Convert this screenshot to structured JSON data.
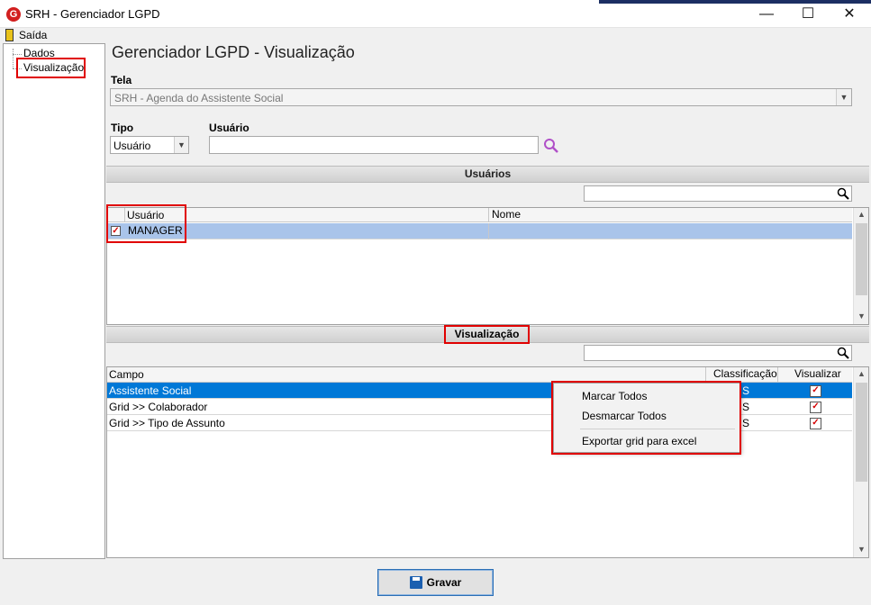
{
  "window": {
    "title": "SRH - Gerenciador LGPD",
    "logo_letter": "G",
    "minimize_glyph": "—",
    "maximize_glyph": "☐",
    "close_glyph": "✕"
  },
  "menu": {
    "exit_label": "Saída"
  },
  "tree": {
    "items": [
      {
        "label": "Dados"
      },
      {
        "label": "Visualização"
      }
    ]
  },
  "page": {
    "title": "Gerenciador LGPD - Visualização"
  },
  "tela": {
    "label": "Tela",
    "value": "SRH - Agenda do Assistente Social"
  },
  "tipo": {
    "label": "Tipo",
    "value": "Usuário"
  },
  "usuario": {
    "label": "Usuário",
    "value": ""
  },
  "usuarios_section": {
    "title": "Usuários",
    "filter_value": "",
    "columns": [
      "Usuário",
      "Nome"
    ],
    "rows": [
      {
        "checked": true,
        "usuario": "MANAGER",
        "nome": ""
      }
    ]
  },
  "vis_section": {
    "title": "Visualização",
    "filter_value": "",
    "columns": [
      "Campo",
      "Classificação",
      "Visualizar"
    ],
    "rows": [
      {
        "campo": "Assistente Social",
        "classificacao": "S",
        "visualizar": true
      },
      {
        "campo": "Grid >> Colaborador",
        "classificacao": "S",
        "visualizar": true
      },
      {
        "campo": "Grid >> Tipo de Assunto",
        "classificacao": "S",
        "visualizar": true
      }
    ]
  },
  "context_menu": {
    "items": [
      "Marcar Todos",
      "Desmarcar Todos",
      "Exportar grid para excel"
    ]
  },
  "footer": {
    "save_label": "Gravar"
  },
  "colors": {
    "selection": "#0078d7",
    "highlight_box": "#e00000",
    "search_icon": "#b050c8"
  },
  "icons": {
    "search": "magnifier-icon",
    "save": "floppy-icon",
    "exit": "door-icon"
  }
}
